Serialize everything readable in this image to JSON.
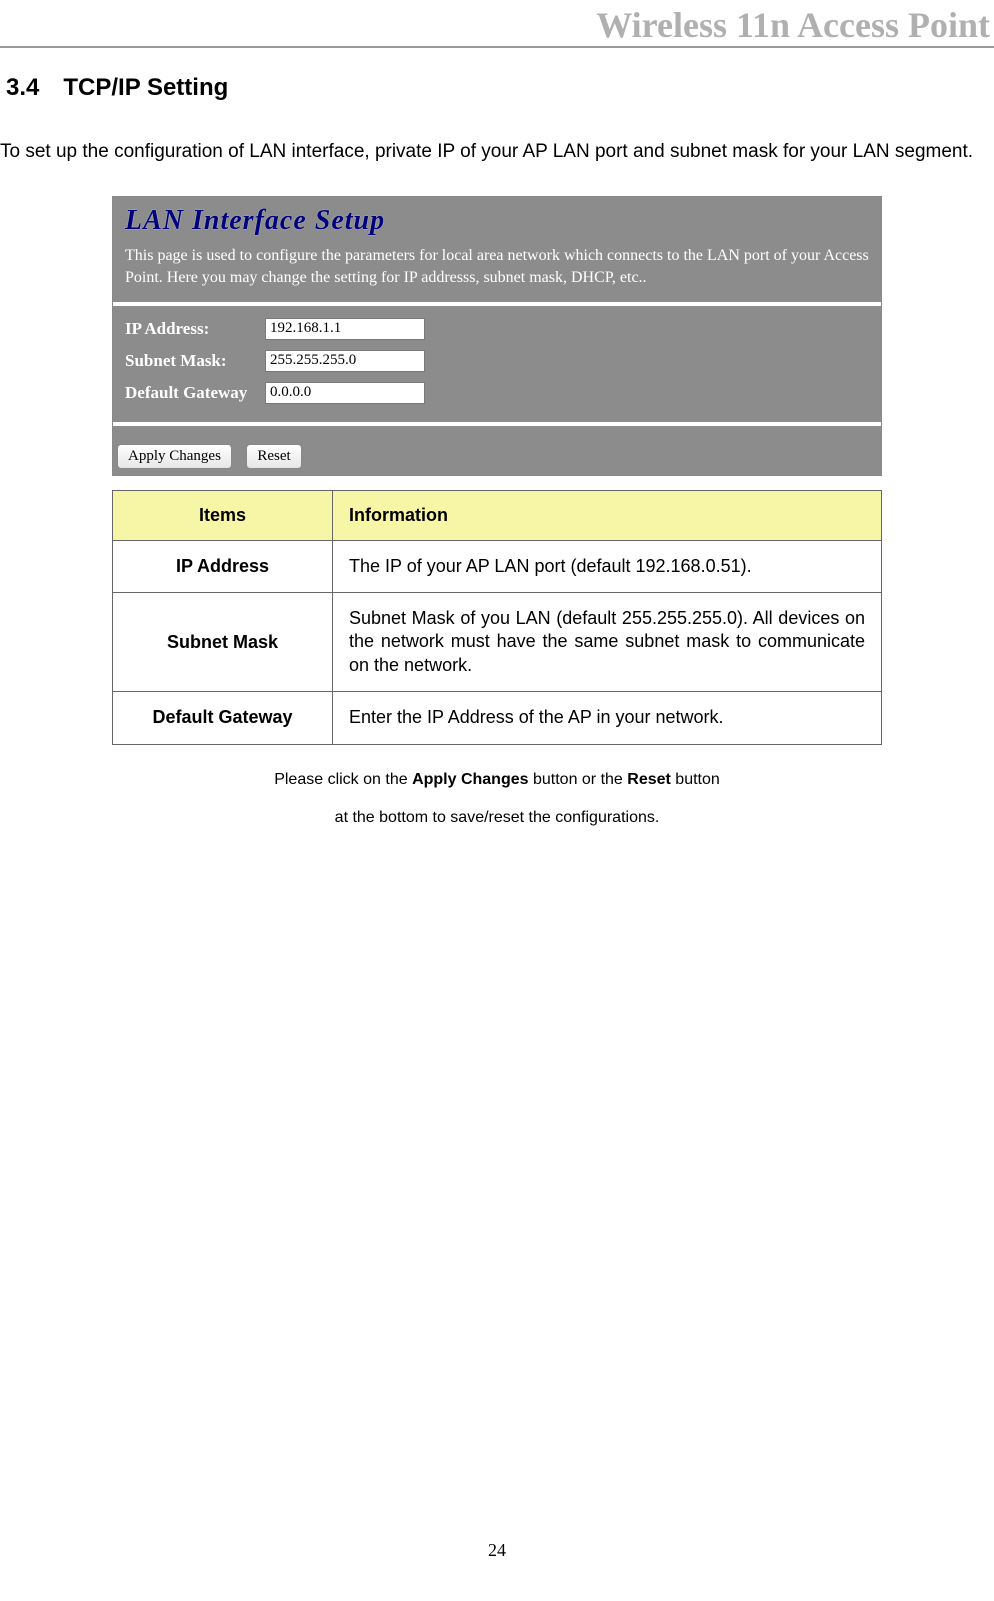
{
  "header": {
    "title": "Wireless 11n Access Point"
  },
  "section": {
    "number": "3.4",
    "title": "TCP/IP Setting",
    "intro": "To set up the configuration of LAN interface, private IP of your AP LAN port and subnet mask for your LAN segment."
  },
  "screenshot": {
    "title": "LAN Interface Setup",
    "description": "This page is used to configure the parameters for local area network which connects to the LAN port of your Access Point. Here you may change the setting for IP addresss, subnet mask, DHCP, etc..",
    "fields": {
      "ip": {
        "label": "IP Address:",
        "value": "192.168.1.1"
      },
      "mask": {
        "label": "Subnet Mask:",
        "value": "255.255.255.0"
      },
      "gateway": {
        "label": "Default Gateway",
        "value": "0.0.0.0"
      }
    },
    "buttons": {
      "apply": "Apply Changes",
      "reset": "Reset"
    }
  },
  "table": {
    "header": {
      "c1": "Items",
      "c2": "Information"
    },
    "rows": [
      {
        "item": "IP Address",
        "info": "The IP of your AP LAN port (default 192.168.0.51)."
      },
      {
        "item": "Subnet Mask",
        "info": "Subnet Mask of you LAN (default 255.255.255.0). All devices on the network must have the same subnet mask to communicate on the network."
      },
      {
        "item": "Default Gateway",
        "info": "Enter the IP Address of the AP in your network."
      }
    ]
  },
  "note": {
    "line1_pre": "Please click on the ",
    "bold1": "Apply Changes",
    "line1_mid": " button or the ",
    "bold2": "Reset",
    "line1_post": " button",
    "line2": "at the bottom to save/reset the configurations."
  },
  "page_number": "24"
}
